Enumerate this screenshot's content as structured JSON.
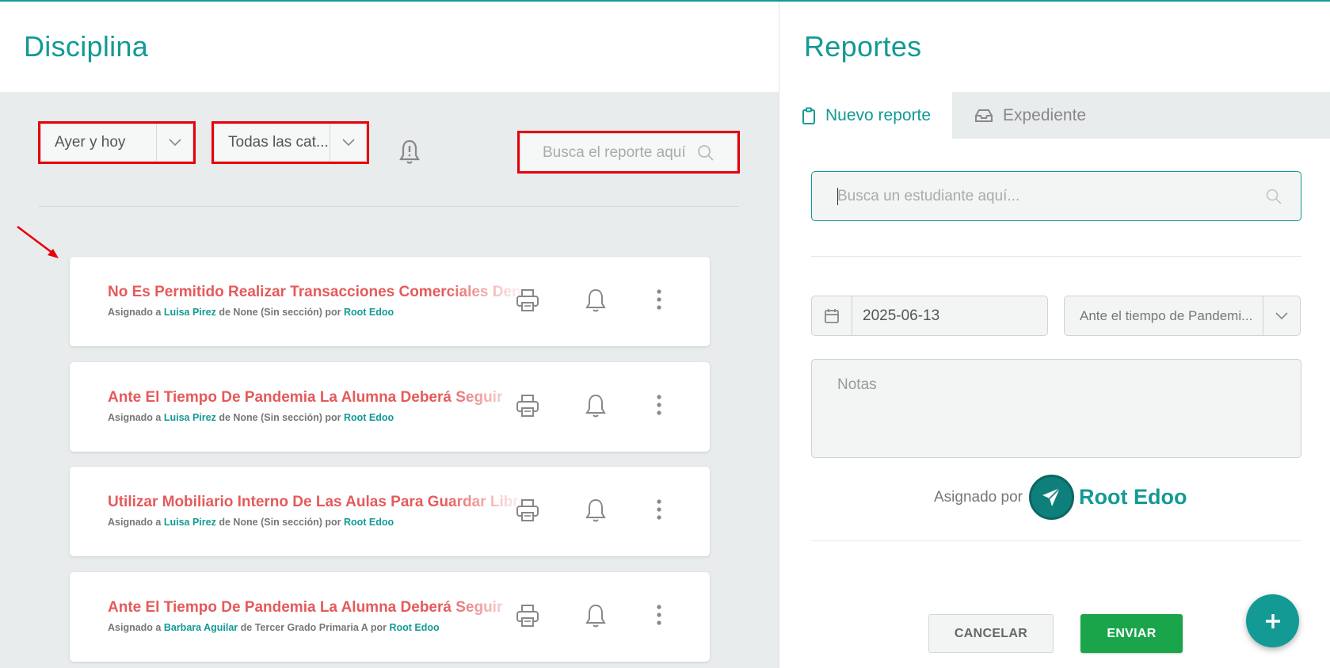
{
  "colors": {
    "accent": "#139a95",
    "title_red": "#e55a5a",
    "send_green": "#1aa54b",
    "highlight_red": "#e8000a"
  },
  "left": {
    "title": "Disciplina",
    "filters": {
      "date_range": "Ayer y hoy",
      "category": "Todas las cat...",
      "search_placeholder": "Busca el reporte aquí"
    },
    "reports": [
      {
        "title": "No Es Permitido Realizar Transacciones Comerciales Dentro",
        "assigned_prefix": "Asignado a ",
        "student": "Luisa Pirez",
        "section_text": " de None (Sin sección) por ",
        "author": "Root Edoo"
      },
      {
        "title": "Ante El Tiempo De Pandemia La Alumna Deberá Seguir",
        "assigned_prefix": "Asignado a ",
        "student": "Luisa Pirez",
        "section_text": " de None (Sin sección) por ",
        "author": "Root Edoo"
      },
      {
        "title": "Utilizar Mobiliario Interno De Las Aulas Para Guardar Libros",
        "assigned_prefix": "Asignado a ",
        "student": "Luisa Pirez",
        "section_text": " de None (Sin sección) por ",
        "author": "Root Edoo"
      },
      {
        "title": "Ante El Tiempo De Pandemia La Alumna Deberá Seguir",
        "assigned_prefix": "Asignado a ",
        "student": "Barbara Aguilar",
        "section_text": " de Tercer Grado Primaria A por ",
        "author": "Root Edoo"
      }
    ]
  },
  "right": {
    "title": "Reportes",
    "tabs": {
      "new_report": "Nuevo reporte",
      "record": "Expediente"
    },
    "student_search_placeholder": "Busca un estudiante aquí...",
    "date_value": "2025-06-13",
    "category_value": "Ante el tiempo de Pandemi...",
    "notes_placeholder": "Notas",
    "assigned_by_label": "Asignado por",
    "assigned_by_name": "Root Edoo",
    "cancel_label": "CANCELAR",
    "send_label": "ENVIAR"
  }
}
